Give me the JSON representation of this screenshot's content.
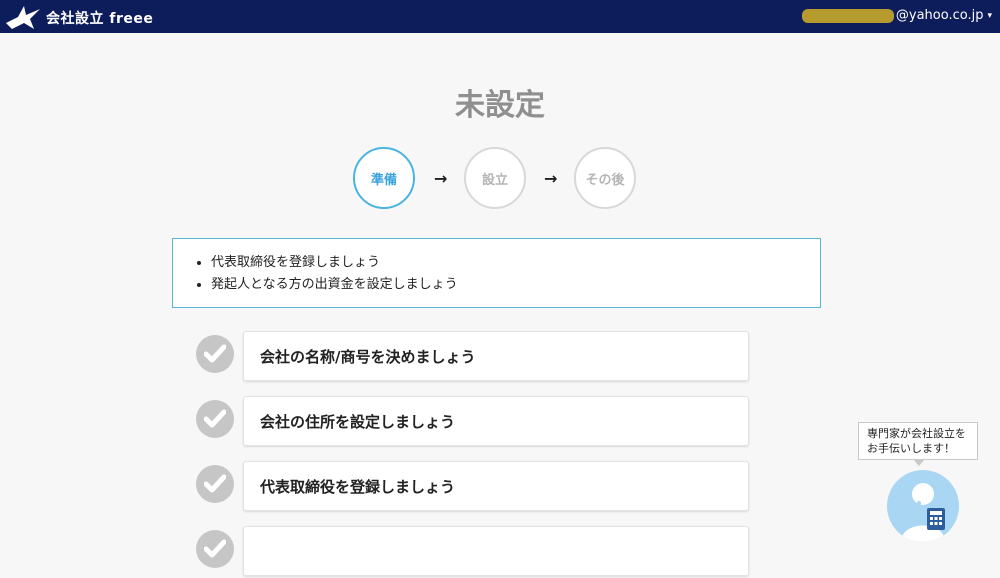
{
  "header": {
    "brand": "会社設立 freee",
    "account_email_suffix": "@yahoo.co.jp",
    "caret": "▾",
    "bg_color": "#0d1d5c"
  },
  "page": {
    "status_title": "未設定"
  },
  "steps": {
    "items": [
      {
        "label": "準備",
        "active": true
      },
      {
        "label": "設立",
        "active": false
      },
      {
        "label": "その後",
        "active": false
      }
    ],
    "arrow": "→",
    "active_color": "#4ab3e2"
  },
  "info": {
    "bullets": [
      "代表取締役を登録しましょう",
      "発起人となる方の出資金を設定しましょう"
    ],
    "border_color": "#56b8cf"
  },
  "tasks": [
    {
      "label": "会社の名称/商号を決めましょう",
      "done": true
    },
    {
      "label": "会社の住所を設定しましょう",
      "done": true
    },
    {
      "label": "代表取締役を登録しましょう",
      "done": true
    },
    {
      "label": "",
      "done": true
    }
  ],
  "help": {
    "line1": "専門家が会社設立を",
    "line2": "お手伝いします！"
  }
}
